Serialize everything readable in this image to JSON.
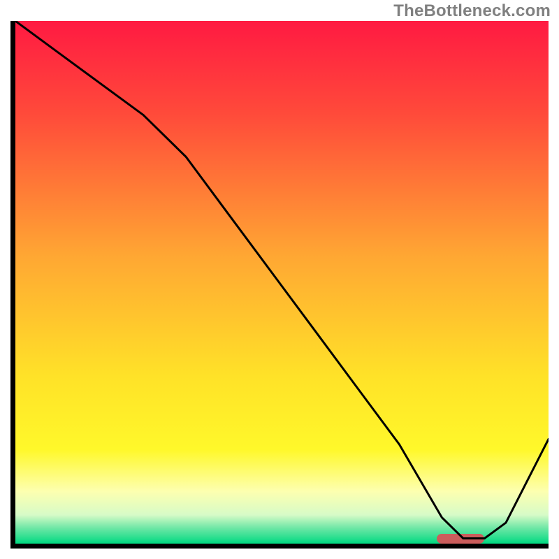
{
  "attribution": "TheBottleneck.com",
  "colors": {
    "gradient_stops": [
      {
        "offset": 0.0,
        "color": "#ff1a42"
      },
      {
        "offset": 0.18,
        "color": "#ff4b3a"
      },
      {
        "offset": 0.45,
        "color": "#ffa733"
      },
      {
        "offset": 0.68,
        "color": "#ffe228"
      },
      {
        "offset": 0.82,
        "color": "#fff82a"
      },
      {
        "offset": 0.9,
        "color": "#fdffb0"
      },
      {
        "offset": 0.945,
        "color": "#d7fbc7"
      },
      {
        "offset": 0.97,
        "color": "#6fe7a6"
      },
      {
        "offset": 1.0,
        "color": "#00d981"
      }
    ],
    "curve": "#000000",
    "marker": "#cb5d5c",
    "axis": "#000000",
    "attribution_text": "#808080"
  },
  "chart_data": {
    "type": "line",
    "title": "",
    "xlabel": "",
    "ylabel": "",
    "xlim": [
      0,
      100
    ],
    "ylim": [
      0,
      100
    ],
    "x": [
      0,
      8,
      16,
      24,
      32,
      40,
      48,
      56,
      64,
      72,
      76,
      80,
      84,
      88,
      92,
      96,
      100
    ],
    "values": [
      100,
      94,
      88,
      82,
      74,
      63,
      52,
      41,
      30,
      19,
      12,
      5,
      1,
      1,
      4,
      12,
      20
    ],
    "marker_range_x": [
      79,
      88
    ]
  }
}
